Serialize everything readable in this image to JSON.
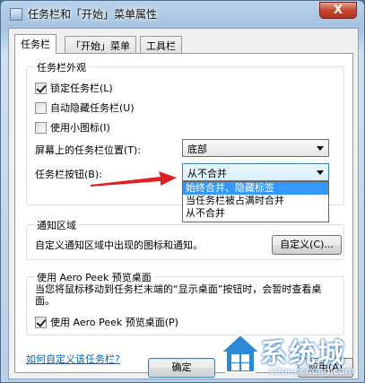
{
  "window": {
    "title": "任务栏和「开始」菜单属性",
    "close_label": "X"
  },
  "tabs": [
    {
      "label": "任务栏"
    },
    {
      "label": "「开始」菜单"
    },
    {
      "label": "工具栏"
    }
  ],
  "appearance": {
    "group_title": "任务栏外观",
    "lock_taskbar": {
      "label": "锁定任务栏(L)",
      "checked": true
    },
    "autohide": {
      "label": "自动隐藏任务栏(U)",
      "checked": false
    },
    "small_icons": {
      "label": "使用小图标(I)",
      "checked": false
    },
    "location_label": "屏幕上的任务栏位置(T):",
    "location_value": "底部",
    "buttons_label": "任务栏按钮(B):",
    "buttons_value": "从不合并",
    "dropdown_options": [
      "始终合并、隐藏标签",
      "当任务栏被占满时合并",
      "从不合并"
    ],
    "dropdown_selected_index": 0
  },
  "notification": {
    "group_title": "通知区域",
    "description": "自定义通知区域中出现的图标和通知。",
    "customize_button": "自定义(C)..."
  },
  "aero": {
    "group_title": "使用 Aero Peek 预览桌面",
    "description": "当您将鼠标移动到任务栏末端的“显示桌面”按钮时，会暂时查看桌面。",
    "checkbox": {
      "label": "使用 Aero Peek 预览桌面(P)",
      "checked": true
    }
  },
  "help_link": "如何自定义该任务栏?",
  "buttons": {
    "ok": "确定",
    "apply": "应用(A)"
  },
  "watermark": {
    "brand": "系统城",
    "url": "xitongcheng.com"
  },
  "colors": {
    "selection": "#3399ff",
    "link": "#0066cc",
    "arrow": "#e02020"
  }
}
